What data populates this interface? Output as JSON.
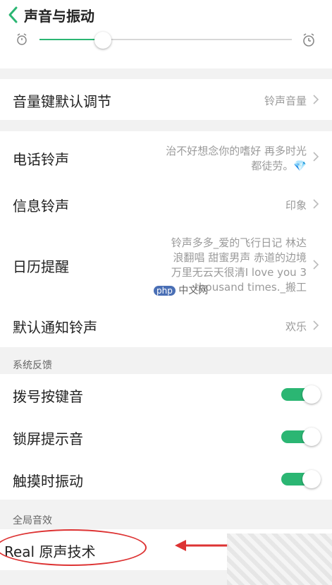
{
  "header": {
    "title": "声音与振动"
  },
  "volume_slider": {
    "level": 0.25,
    "accent": "#2bb673"
  },
  "volume_key": {
    "label": "音量键默认调节",
    "value": "铃声音量"
  },
  "ringtones": [
    {
      "label": "电话铃声",
      "value": "治不好想念你的嗜好 再多时光\n都徒劳。💎"
    },
    {
      "label": "信息铃声",
      "value": "印象"
    },
    {
      "label": "日历提醒",
      "value": "铃声多多_爱的飞行日记 林达\n浪翻唱 甜蜜男声 赤道的边境\n万里无云天很清I love you 3\nthousand times._搬工"
    },
    {
      "label": "默认通知铃声",
      "value": "欢乐"
    }
  ],
  "system_feedback": {
    "header": "系统反馈",
    "items": [
      {
        "label": "拨号按键音",
        "on": true
      },
      {
        "label": "锁屏提示音",
        "on": true
      },
      {
        "label": "触摸时振动",
        "on": true
      }
    ]
  },
  "global_sound": {
    "header": "全局音效",
    "items": [
      {
        "label": "Real 原声技术"
      }
    ]
  },
  "watermark": {
    "badge": "php",
    "text": "中文网"
  },
  "colors": {
    "toggle_on": "#2bb673",
    "annotation": "#dd3333"
  }
}
